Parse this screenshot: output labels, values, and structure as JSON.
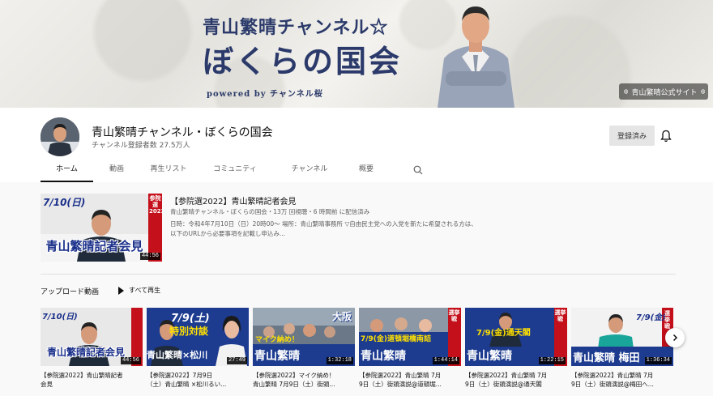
{
  "banner": {
    "title_line1": "青山繁晴チャンネル☆",
    "title_line2": "ぼくらの国会",
    "powered": "powered by チャンネル桜",
    "link_label": "青山繁晴公式サイト"
  },
  "channel": {
    "name": "青山繁晴チャンネル・ぼくらの国会",
    "subscribers": "チャンネル登録者数 27.5万人",
    "subscribe_label": "登録済み"
  },
  "tabs": [
    "ホーム",
    "動画",
    "再生リスト",
    "コミュニティ",
    "チャンネル",
    "概要"
  ],
  "featured": {
    "title": "【参院選2022】青山繁晴記者会見",
    "meta": "青山繁晴チャンネル・ぼくらの国会・13万 回視聴・6 時間前 に配信済み",
    "desc_line1": "日時：令和4年7月10日（日）20時00～ 場所：青山繁晴事務所 ▽自由民主党への入党を新たに希望される方は、",
    "desc_line2": "以下のURLから必要事項を記載し申込み...",
    "duration": "44:56",
    "thumb_date": "7/10(日)",
    "thumb_side": "参院選2022",
    "thumb_banner": "青山繁晴記者会見"
  },
  "uploads": {
    "title": "アップロード動画",
    "play_all": "すべて再生"
  },
  "videos": [
    {
      "title_line1": "【参院選2022】青山繁晴記者",
      "title_line2": "会見",
      "duration": "44:56",
      "thumb_top": "7/10(日)",
      "thumb_bottom": "青山繁晴記者会見"
    },
    {
      "title_line1": "【参院選2022】7月9日",
      "title_line2": "（土）青山繁晴 ×松川るい...",
      "duration": "27:49",
      "thumb_top": "7/9(土)",
      "thumb_mid": "特別対談",
      "thumb_bottom": "青山繁晴×松川"
    },
    {
      "title_line1": "【参院選2022】マイク納め！",
      "title_line2": "青山繁晴 7月9日（土）街頭...",
      "duration": "1:32:18",
      "thumb_top": "大阪",
      "thumb_mid": "マイク納め！",
      "thumb_bottom": "青山繁晴"
    },
    {
      "title_line1": "【参院選2022】青山繁晴 7月",
      "title_line2": "9日（土）街頭演説@道頓堀...",
      "duration": "1:44:14",
      "thumb_top": "選挙戦",
      "thumb_mid": "7/9(金)道頓堀橋南詰",
      "thumb_bottom": "青山繁晴"
    },
    {
      "title_line1": "【参院選2022】青山繁晴 7月",
      "title_line2": "9日（土）街頭演説@通天閣",
      "duration": "1:22:15",
      "thumb_top": "選挙戦",
      "thumb_mid": "7/9(金)通天閣",
      "thumb_bottom": "青山繁晴"
    },
    {
      "title_line1": "【参院選2022】青山繁晴 7月",
      "title_line2": "9日（土）街頭演説@梅田へ...",
      "duration": "1:36:34",
      "thumb_top": "7/9(金)",
      "thumb_mid": "選挙戦",
      "thumb_bottom": "青山繁晴 梅田"
    }
  ]
}
